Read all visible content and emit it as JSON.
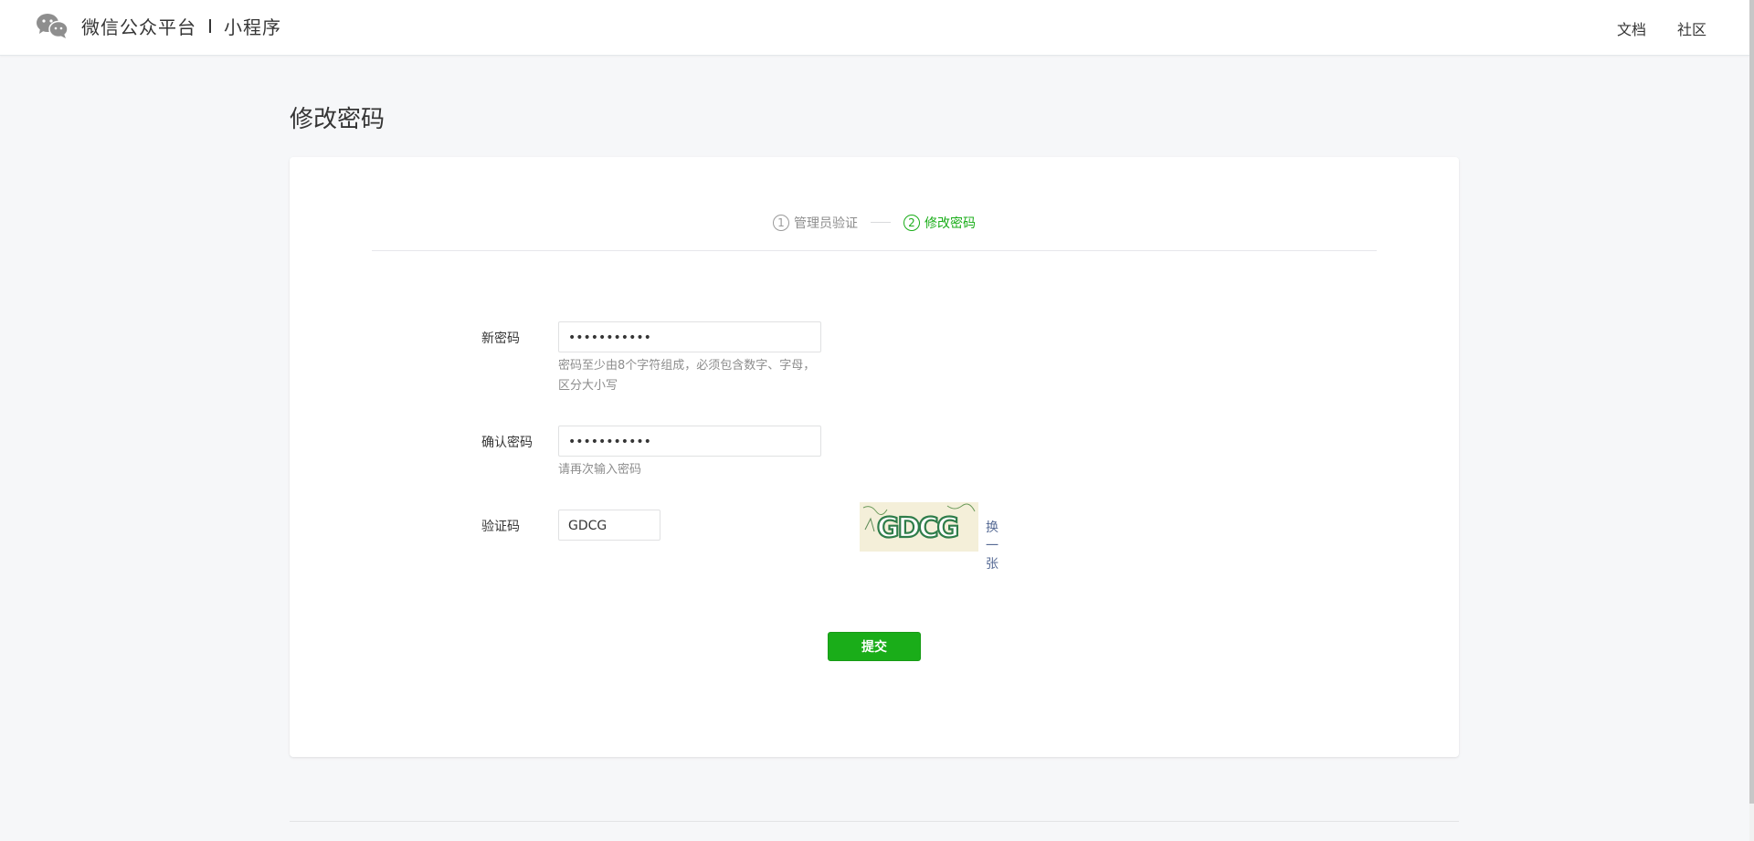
{
  "header": {
    "brand_name": "微信公众平台",
    "product": "小程序",
    "nav": [
      {
        "label": "文档"
      },
      {
        "label": "社区"
      }
    ]
  },
  "page": {
    "title": "修改密码"
  },
  "steps": [
    {
      "num": "1",
      "label": "管理员验证",
      "active": false
    },
    {
      "num": "2",
      "label": "修改密码",
      "active": true
    }
  ],
  "form": {
    "new_password": {
      "label": "新密码",
      "value": "•••••••••••",
      "hint": "密码至少由8个字符组成，必须包含数字、字母，区分大小写"
    },
    "confirm_password": {
      "label": "确认密码",
      "value": "•••••••••••",
      "hint": "请再次输入密码"
    },
    "captcha": {
      "label": "验证码",
      "value": "GDCG",
      "image_text": "GDCG",
      "refresh_label": "换一张"
    },
    "submit_label": "提交"
  },
  "colors": {
    "accent": "#1aad19",
    "link": "#576b95",
    "background": "#f6f7f9"
  }
}
